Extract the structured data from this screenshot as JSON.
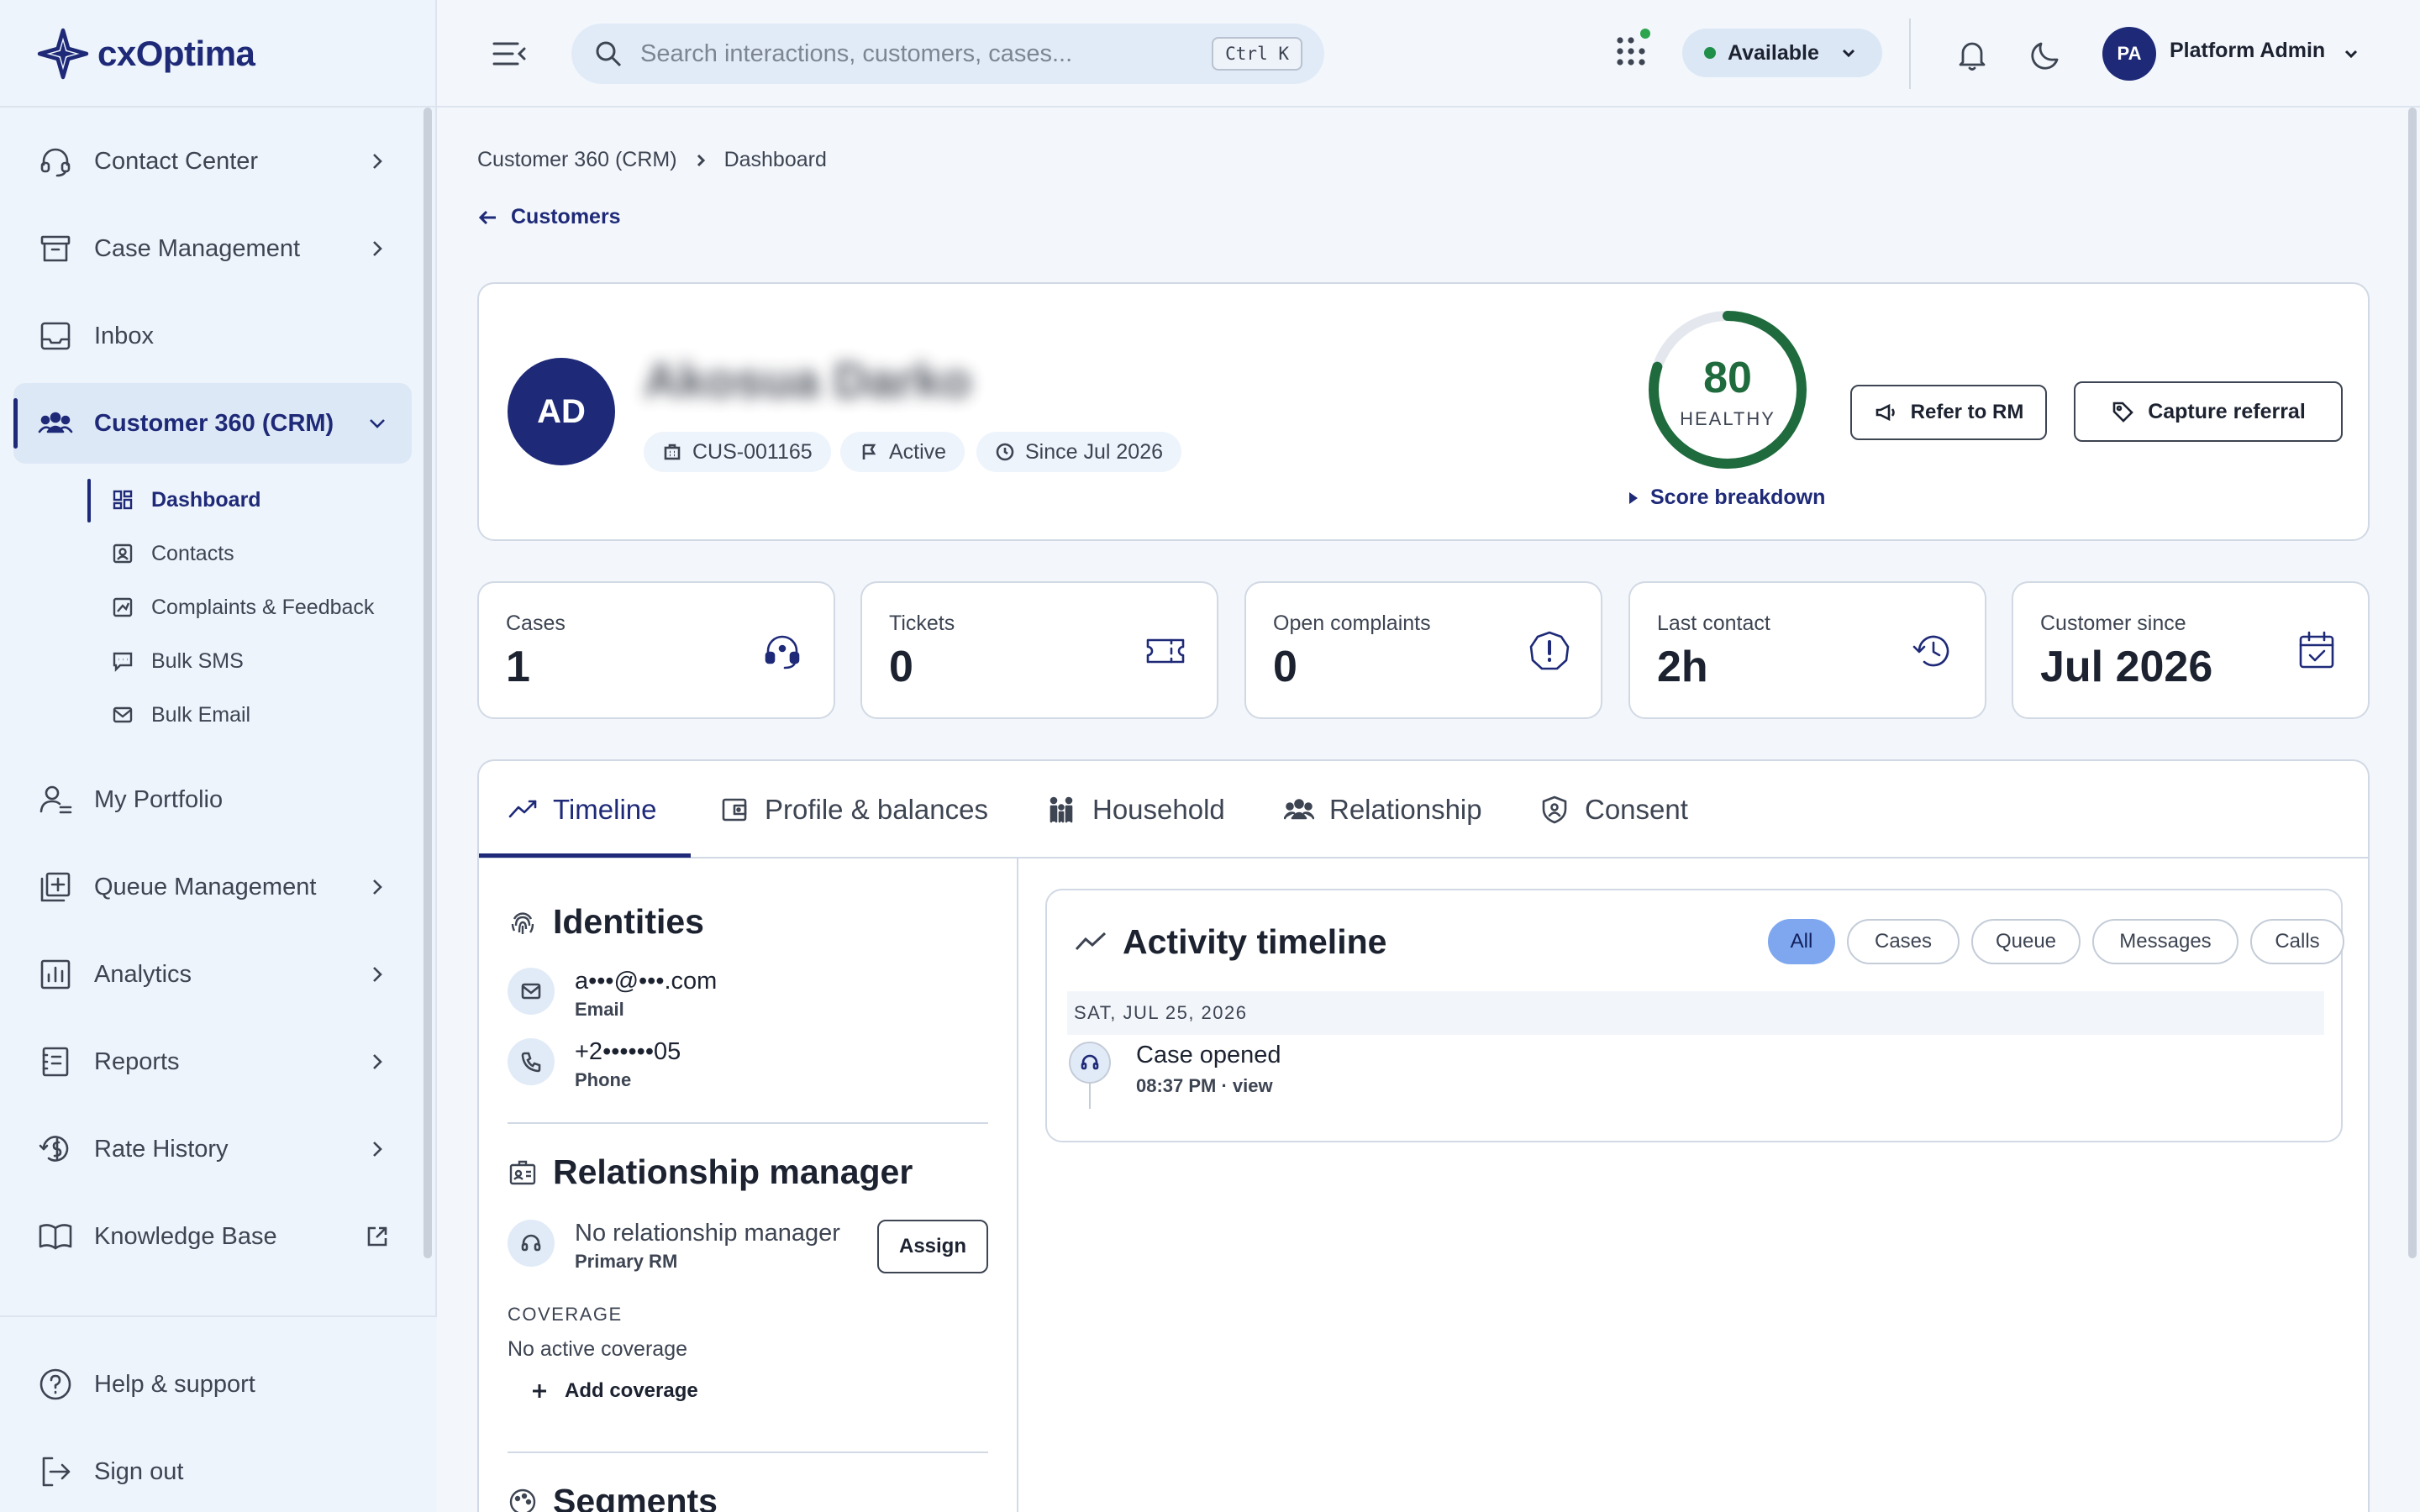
{
  "app": {
    "name": "cxOptima"
  },
  "sidebar": {
    "items": [
      {
        "label": "Contact Center",
        "icon": "headset-icon"
      },
      {
        "label": "Case Management",
        "icon": "archive-icon"
      },
      {
        "label": "Inbox",
        "icon": "inbox-icon"
      },
      {
        "label": "Customer 360 (CRM)",
        "icon": "users-icon"
      },
      {
        "label": "My Portfolio",
        "icon": "user-portfolio-icon"
      },
      {
        "label": "Queue Management",
        "icon": "queue-add-icon"
      },
      {
        "label": "Analytics",
        "icon": "bar-chart-icon"
      },
      {
        "label": "Reports",
        "icon": "report-icon"
      },
      {
        "label": "Rate History",
        "icon": "currency-history-icon"
      },
      {
        "label": "Knowledge Base",
        "icon": "book-icon"
      }
    ],
    "sub_items": [
      {
        "label": "Dashboard",
        "icon": "dashboard-icon"
      },
      {
        "label": "Contacts",
        "icon": "contacts-icon"
      },
      {
        "label": "Complaints & Feedback",
        "icon": "feedback-icon"
      },
      {
        "label": "Bulk SMS",
        "icon": "message-icon"
      },
      {
        "label": "Bulk Email",
        "icon": "mail-icon"
      }
    ],
    "bottom": [
      {
        "label": "Help & support",
        "icon": "help-icon"
      },
      {
        "label": "Sign out",
        "icon": "sign-out-icon"
      }
    ]
  },
  "header": {
    "search_placeholder": "Search interactions, customers, cases...",
    "search_shortcut": "Ctrl K",
    "status": "Available",
    "user_initials": "PA",
    "user_name": "Platform Admin"
  },
  "breadcrumb": {
    "parent": "Customer 360 (CRM)",
    "current": "Dashboard"
  },
  "back_link": "Customers",
  "customer": {
    "initials": "AD",
    "name": "Akosua Darko",
    "id": "CUS-001165",
    "status": "Active",
    "since": "Since Jul 2026",
    "health_score": 80,
    "health_label": "HEALTHY",
    "score_breakdown": "Score breakdown",
    "refer_label": "Refer to RM",
    "capture_label": "Capture referral",
    "colors": {
      "brand": "#1e2a78",
      "health": "#1f6b3d"
    }
  },
  "stats": [
    {
      "label": "Cases",
      "value": "1",
      "icon": "headset-icon"
    },
    {
      "label": "Tickets",
      "value": "0",
      "icon": "ticket-icon"
    },
    {
      "label": "Open complaints",
      "value": "0",
      "icon": "alert-icon"
    },
    {
      "label": "Last contact",
      "value": "2h",
      "icon": "history-icon"
    },
    {
      "label": "Customer since",
      "value": "Jul 2026",
      "icon": "calendar-check-icon"
    }
  ],
  "tabs": [
    {
      "label": "Timeline"
    },
    {
      "label": "Profile & balances"
    },
    {
      "label": "Household"
    },
    {
      "label": "Relationship"
    },
    {
      "label": "Consent"
    }
  ],
  "identities": {
    "title": "Identities",
    "items": [
      {
        "value": "a•••@•••.com",
        "type": "Email"
      },
      {
        "value": "+2••••••05",
        "type": "Phone"
      }
    ]
  },
  "relationship_manager": {
    "title": "Relationship manager",
    "name": "No relationship manager",
    "role": "Primary RM",
    "assign_label": "Assign",
    "coverage_label": "COVERAGE",
    "coverage_value": "No active coverage",
    "add_coverage": "Add coverage"
  },
  "segments": {
    "title": "Segments"
  },
  "activity": {
    "title": "Activity timeline",
    "filters": [
      "All",
      "Cases",
      "Queue",
      "Messages",
      "Calls"
    ],
    "day": "SAT, JUL 25, 2026",
    "events": [
      {
        "title": "Case opened",
        "meta": "08:37 PM · view"
      }
    ]
  }
}
